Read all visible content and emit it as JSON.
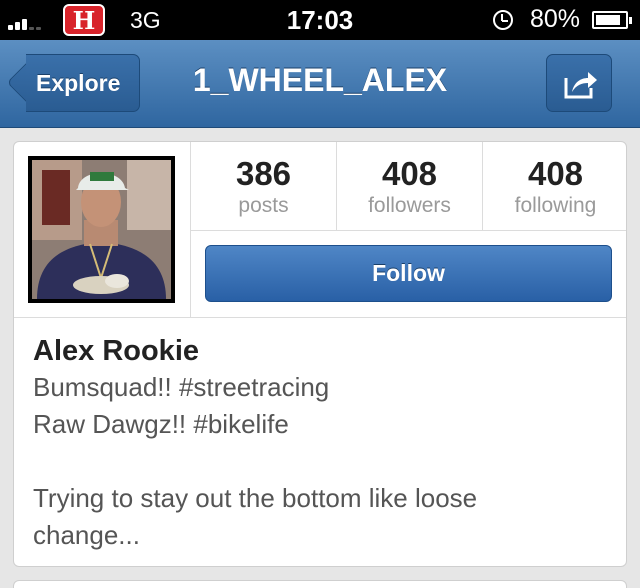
{
  "status_bar": {
    "carrier_logo": "H",
    "network": "3G",
    "time": "17:03",
    "battery": "80%",
    "icons": [
      "signal-icon",
      "carrier-logo-icon",
      "alarm-icon",
      "battery-icon"
    ]
  },
  "nav": {
    "back_label": "Explore",
    "title": "1_WHEEL_ALEX",
    "share_icon": "share-icon"
  },
  "profile": {
    "stats": [
      {
        "count": "386",
        "label": "posts"
      },
      {
        "count": "408",
        "label": "followers"
      },
      {
        "count": "408",
        "label": "following"
      }
    ],
    "follow_label": "Follow"
  },
  "bio": {
    "name": "Alex Rookie",
    "lines": [
      "Bumsquad!! #streetracing",
      "Raw Dawgz!! #bikelife",
      "",
      "Trying to stay out the bottom like loose",
      "change..."
    ]
  },
  "colors": {
    "nav_bar": "#3f74ad",
    "follow_button": "#3a72b6",
    "background": "#e6e6e6"
  }
}
